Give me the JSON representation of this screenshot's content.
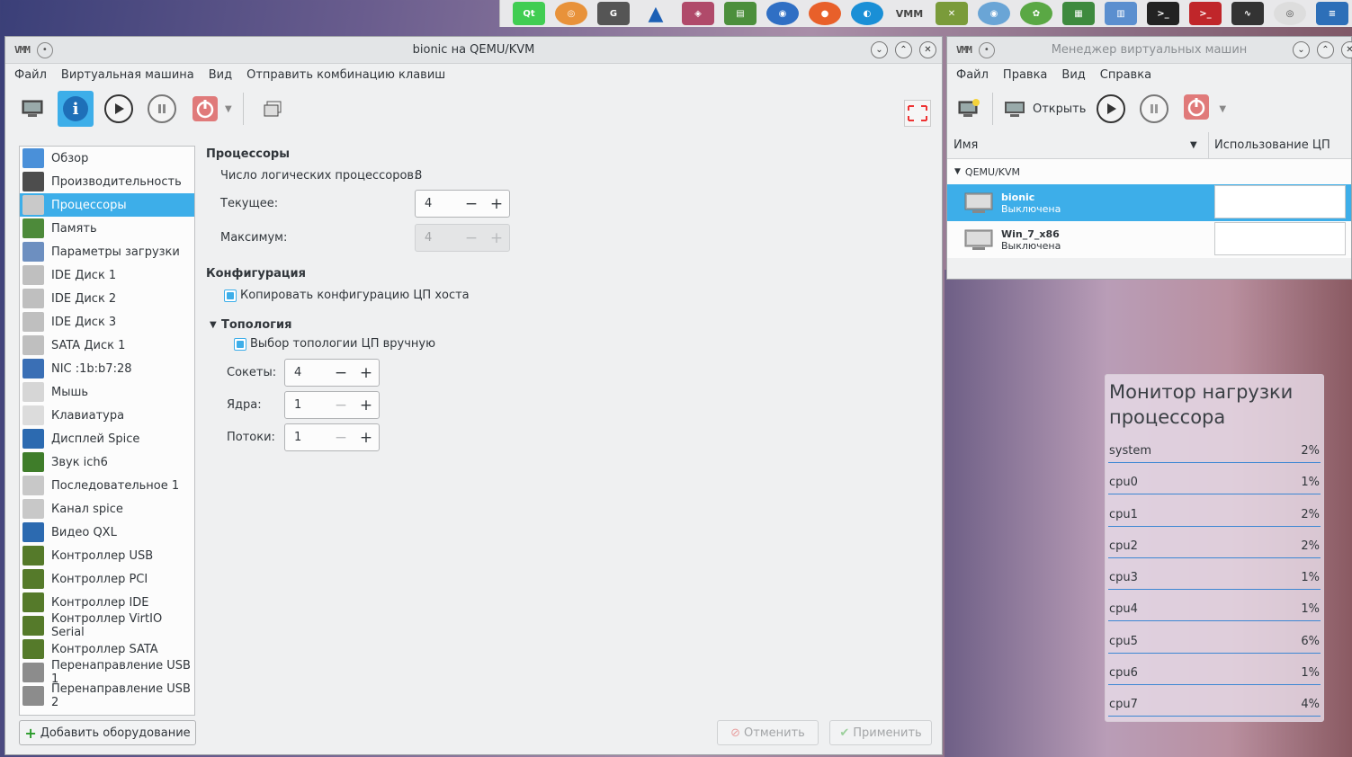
{
  "dock": {
    "icons": [
      "qt-creator-icon",
      "spiral-icon",
      "git-icon",
      "triangle-icon",
      "package-icon",
      "books-icon",
      "network-globe-icon",
      "firefox-icon",
      "browser-icon",
      "virt-manager-icon",
      "tools-icon",
      "eye-icon",
      "leaf-icon",
      "calculator-icon",
      "file-manager-icon",
      "terminal-icon",
      "terminal-red-icon",
      "system-monitor-icon",
      "webcam-icon",
      "text-editor-icon"
    ]
  },
  "vm_window": {
    "title": "bionic на QEMU/KVM",
    "logo": "VMM",
    "menu": [
      "Файл",
      "Виртуальная машина",
      "Вид",
      "Отправить комбинацию клавиш"
    ],
    "hardware_list": [
      {
        "label": "Обзор",
        "icon": "overview-icon",
        "color": "#4a90d9"
      },
      {
        "label": "Производительность",
        "icon": "performance-icon",
        "color": "#4d4d4d"
      },
      {
        "label": "Процессоры",
        "icon": "processor-icon",
        "color": "#c9c9c9",
        "selected": true
      },
      {
        "label": "Память",
        "icon": "memory-icon",
        "color": "#4d8a3a"
      },
      {
        "label": "Параметры загрузки",
        "icon": "boot-options-icon",
        "color": "#6d8fc0"
      },
      {
        "label": "IDE Диск 1",
        "icon": "disk-icon",
        "color": "#bfbfbf"
      },
      {
        "label": "IDE Диск 2",
        "icon": "disk-icon",
        "color": "#bfbfbf"
      },
      {
        "label": "IDE Диск 3",
        "icon": "disk-icon",
        "color": "#bfbfbf"
      },
      {
        "label": "SATA Диск 1",
        "icon": "disk-icon",
        "color": "#bfbfbf"
      },
      {
        "label": "NIC :1b:b7:28",
        "icon": "network-icon",
        "color": "#3a6fb5"
      },
      {
        "label": "Мышь",
        "icon": "mouse-icon",
        "color": "#d6d6d6"
      },
      {
        "label": "Клавиатура",
        "icon": "keyboard-icon",
        "color": "#dcdcdc"
      },
      {
        "label": "Дисплей Spice",
        "icon": "display-icon",
        "color": "#2c6ab0"
      },
      {
        "label": "Звук ich6",
        "icon": "sound-icon",
        "color": "#3f7d2a"
      },
      {
        "label": "Последовательное 1",
        "icon": "serial-icon",
        "color": "#c8c8c8"
      },
      {
        "label": "Канал spice",
        "icon": "channel-icon",
        "color": "#c8c8c8"
      },
      {
        "label": "Видео QXL",
        "icon": "video-icon",
        "color": "#2c6ab0"
      },
      {
        "label": "Контроллер USB",
        "icon": "controller-icon",
        "color": "#557a2a"
      },
      {
        "label": "Контроллер PCI",
        "icon": "controller-icon",
        "color": "#557a2a"
      },
      {
        "label": "Контроллер IDE",
        "icon": "controller-icon",
        "color": "#557a2a"
      },
      {
        "label": "Контроллер VirtIO Serial",
        "icon": "controller-icon",
        "color": "#557a2a"
      },
      {
        "label": "Контроллер SATA",
        "icon": "controller-icon",
        "color": "#557a2a"
      },
      {
        "label": "Перенаправление USB 1",
        "icon": "usb-icon",
        "color": "#8c8c8c"
      },
      {
        "label": "Перенаправление USB 2",
        "icon": "usb-icon",
        "color": "#8c8c8c"
      }
    ],
    "add_hardware": "Добавить оборудование",
    "cancel": "Отменить",
    "apply": "Применить",
    "processors": {
      "section_title": "Процессоры",
      "logical_label": "Число логических процессоров:",
      "logical_value": "8",
      "current_label": "Текущее:",
      "current_value": "4",
      "max_label": "Максимум:",
      "max_value": "4"
    },
    "configuration": {
      "section_title": "Конфигурация",
      "copy_host_label": "Копировать конфигурацию ЦП хоста",
      "copy_host_checked": true
    },
    "topology": {
      "section_title": "Топология",
      "manual_label": "Выбор топологии ЦП вручную",
      "manual_checked": true,
      "sockets_label": "Сокеты:",
      "sockets_value": "4",
      "cores_label": "Ядра:",
      "cores_value": "1",
      "threads_label": "Потоки:",
      "threads_value": "1"
    }
  },
  "manager_window": {
    "title": "Менеджер виртуальных машин",
    "logo": "VMM",
    "menu": [
      "Файл",
      "Правка",
      "Вид",
      "Справка"
    ],
    "open_label": "Открыть",
    "col_name": "Имя",
    "col_cpu": "Использование ЦП",
    "group": "QEMU/KVM",
    "vms": [
      {
        "name": "bionic",
        "status": "Выключена",
        "selected": true
      },
      {
        "name": "Win_7_x86",
        "status": "Выключена",
        "selected": false
      }
    ]
  },
  "cpu_monitor": {
    "title": "Монитор нагрузки процессора",
    "rows": [
      {
        "name": "system",
        "value": "2%"
      },
      {
        "name": "cpu0",
        "value": "1%"
      },
      {
        "name": "cpu1",
        "value": "2%"
      },
      {
        "name": "cpu2",
        "value": "2%"
      },
      {
        "name": "cpu3",
        "value": "1%"
      },
      {
        "name": "cpu4",
        "value": "1%"
      },
      {
        "name": "cpu5",
        "value": "6%"
      },
      {
        "name": "cpu6",
        "value": "1%"
      },
      {
        "name": "cpu7",
        "value": "4%"
      }
    ]
  }
}
